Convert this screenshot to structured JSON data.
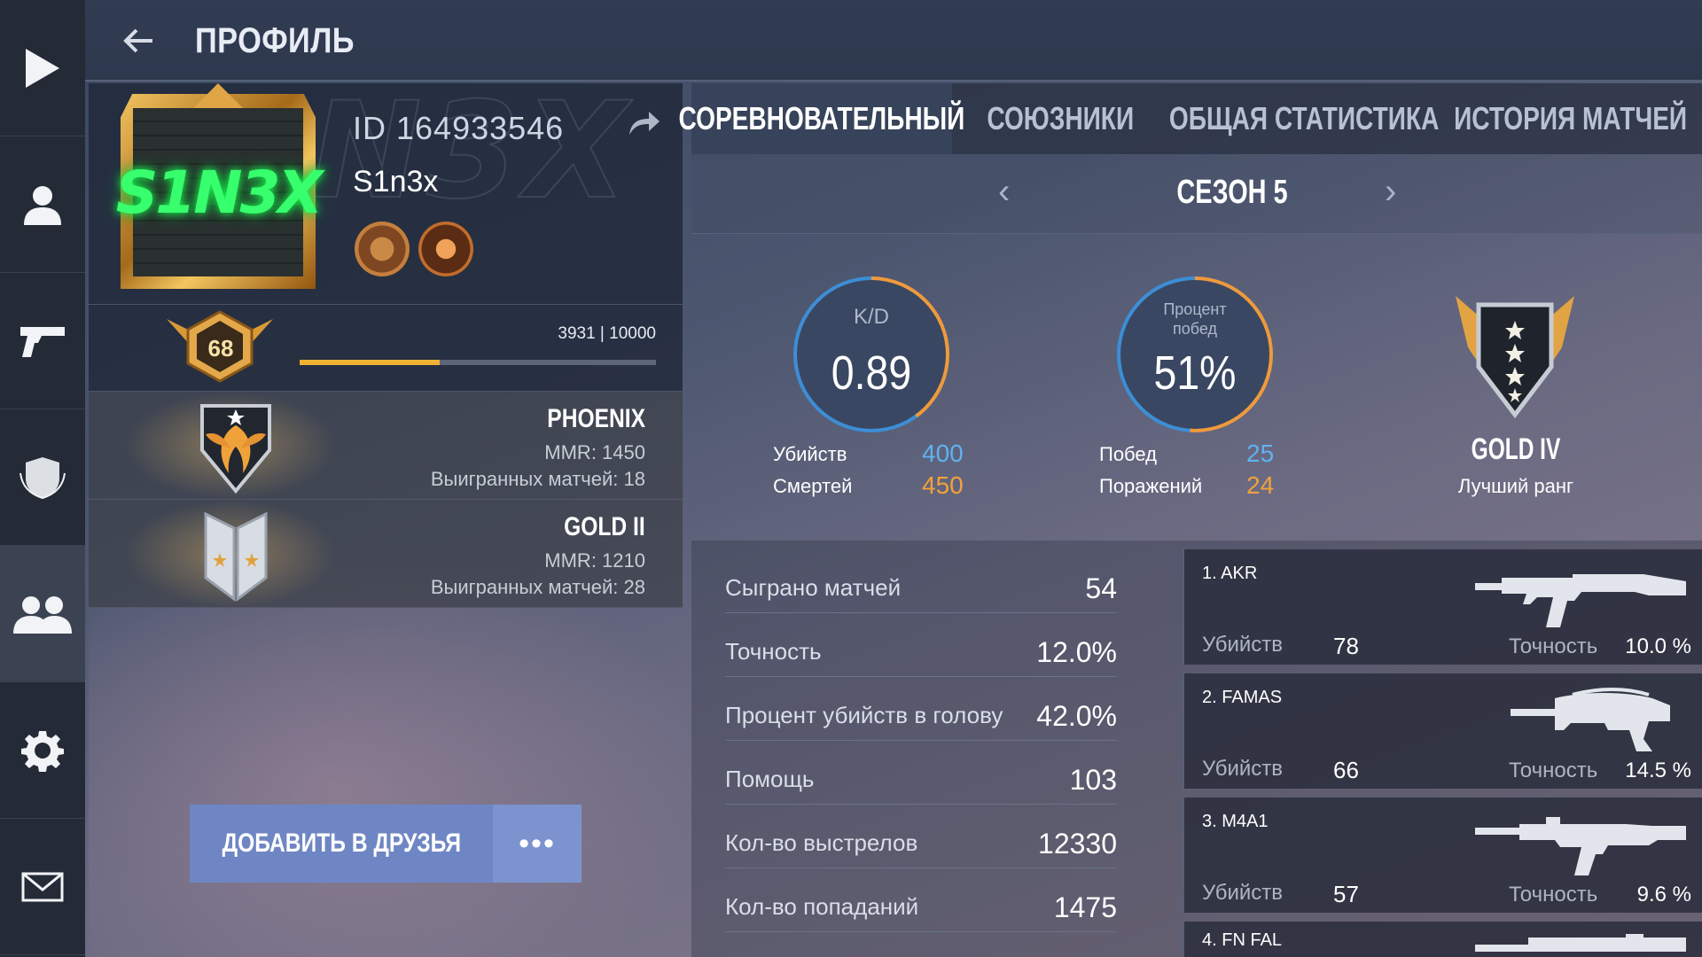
{
  "header": {
    "title": "ПРОФИЛЬ"
  },
  "sidebar": {
    "items": [
      "play-icon",
      "profile-icon",
      "weapon-icon",
      "clan-icon",
      "friends-icon",
      "settings-icon",
      "mail-icon"
    ]
  },
  "profile": {
    "id": "ID 164933546",
    "name": "S1n3x",
    "avatar_text": "S1N3X",
    "level": "68",
    "xp": "3931 | 10000",
    "xp_progress": 0.3931
  },
  "ranks": [
    {
      "name": "PHOENIX",
      "mmr": "MMR: 1450",
      "wins": "Выигранных матчей: 18"
    },
    {
      "name": "GOLD II",
      "mmr": "MMR: 1210",
      "wins": "Выигранных матчей: 28"
    }
  ],
  "actions": {
    "add_friend": "ДОБАВИТЬ В ДРУЗЬЯ",
    "more": "•••"
  },
  "tabs": [
    "СОРЕВНОВАТЕЛЬНЫЙ",
    "СОЮЗНИКИ",
    "ОБЩАЯ СТАТИСТИКА",
    "ИСТОРИЯ МАТЧЕЙ"
  ],
  "season": {
    "title": "СЕЗОН 5",
    "prev": "‹",
    "next": "›"
  },
  "kd": {
    "label": "K/D",
    "value": "0.89",
    "kills_label": "Убийств",
    "kills": "400",
    "deaths_label": "Смертей",
    "deaths": "450"
  },
  "winrate": {
    "label": "Процент побед",
    "value": "51%",
    "wins_label": "Побед",
    "wins": "25",
    "losses_label": "Поражений",
    "losses": "24"
  },
  "best_rank": {
    "name": "GOLD IV",
    "label": "Лучший ранг"
  },
  "stats": [
    {
      "label": "Сыграно матчей",
      "value": "54"
    },
    {
      "label": "Точность",
      "value": "12.0%"
    },
    {
      "label": "Процент убийств в голову",
      "value": "42.0%"
    },
    {
      "label": "Помощь",
      "value": "103"
    },
    {
      "label": "Кол-во выстрелов",
      "value": "12330"
    },
    {
      "label": "Кол-во попаданий",
      "value": "1475"
    }
  ],
  "weapons": [
    {
      "name": "1. AKR",
      "kills_label": "Убийств",
      "kills": "78",
      "acc_label": "Точность",
      "acc": "10.0 %"
    },
    {
      "name": "2. FAMAS",
      "kills_label": "Убийств",
      "kills": "66",
      "acc_label": "Точность",
      "acc": "14.5 %"
    },
    {
      "name": "3. M4A1",
      "kills_label": "Убийств",
      "kills": "57",
      "acc_label": "Точность",
      "acc": "9.6 %"
    },
    {
      "name": "4. FN FAL"
    }
  ],
  "colors": {
    "accent": "#6f86c4",
    "kills": "#5fb2f1",
    "deaths": "#f2a13a",
    "xp": "#f0b132"
  }
}
